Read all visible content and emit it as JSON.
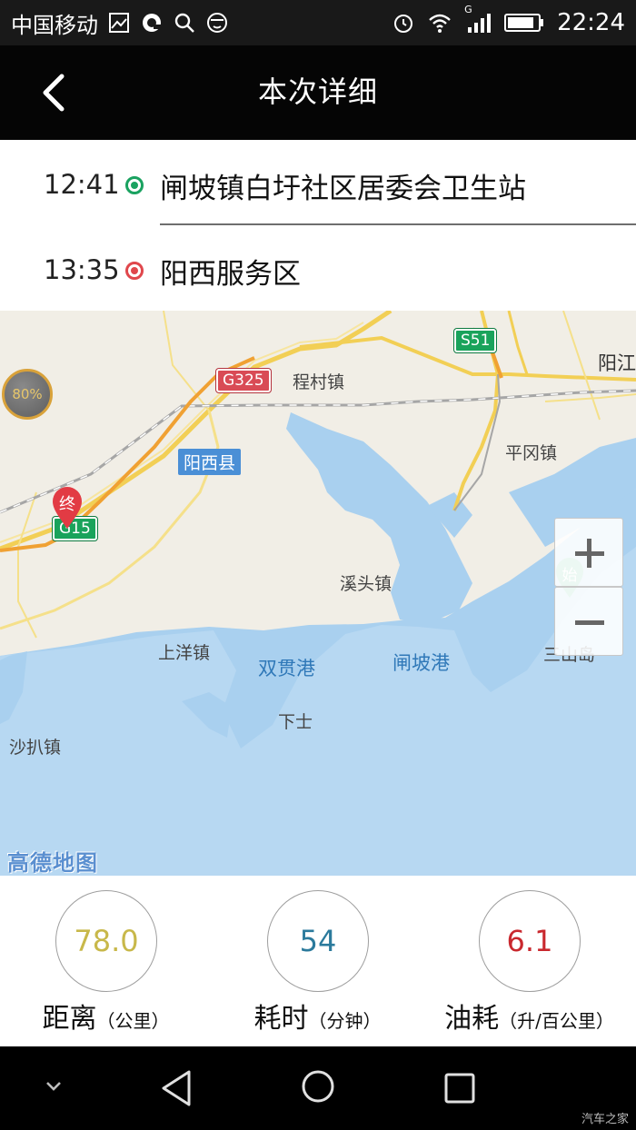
{
  "status_bar": {
    "carrier": "中国移动",
    "network_type": "G",
    "time": "22:24",
    "icons": [
      "image-icon",
      "qq-icon",
      "search-icon",
      "face-icon",
      "alarm-icon",
      "wifi-icon",
      "signal-icon",
      "battery-icon"
    ]
  },
  "header": {
    "title": "本次详细",
    "back_icon": "chevron-left-icon"
  },
  "route": {
    "start": {
      "time": "12:41",
      "place": "闸坡镇白圩社区居委会卫生站",
      "dot_color": "#1aa260"
    },
    "end": {
      "time": "13:35",
      "place": "阳西服务区",
      "dot_color": "#e0474c"
    }
  },
  "map": {
    "battery_badge": "80%",
    "end_marker": "终",
    "start_marker": "始",
    "shields": {
      "g325": "G325",
      "s51": "S51",
      "g15": "G15"
    },
    "county": "阳西县",
    "towns": {
      "chengcun": "程村镇",
      "pinggang": "平冈镇",
      "xitou": "溪头镇",
      "shangyang": "上洋镇",
      "xiashi": "下士",
      "shapa": "沙扒镇",
      "yangjiang": "阳江",
      "sanshandao": "三山岛"
    },
    "water": {
      "shuangguan": "双贯港",
      "zhapo": "闸坡港"
    },
    "logo": "高德地图",
    "zoom_in_icon": "plus-icon",
    "zoom_out_icon": "minus-icon"
  },
  "stats": {
    "distance": {
      "value": "78.0",
      "label": "距离",
      "unit": "（公里）",
      "color": "#c8b84a"
    },
    "duration": {
      "value": "54",
      "label": "耗时",
      "unit": "（分钟）",
      "color": "#2b7a9c"
    },
    "fuel": {
      "value": "6.1",
      "label": "油耗",
      "unit": "（升/百公里）",
      "color": "#c9282e"
    }
  },
  "system_nav": {
    "icons": [
      "hide-keyboard-icon",
      "back-triangle-icon",
      "home-circle-icon",
      "recents-square-icon"
    ]
  },
  "watermark": "汽车之家"
}
